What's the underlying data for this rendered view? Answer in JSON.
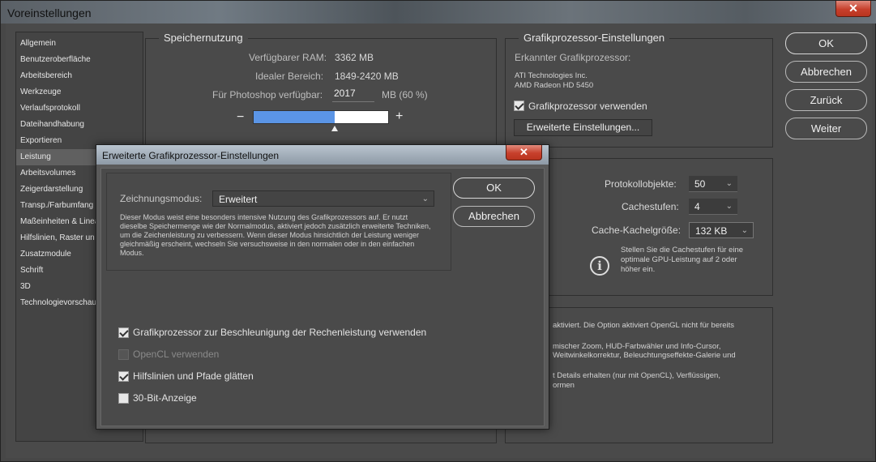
{
  "window": {
    "title": "Voreinstellungen",
    "close_glyph": "✕"
  },
  "sidebar": {
    "items": [
      {
        "label": "Allgemein"
      },
      {
        "label": "Benutzeroberfläche"
      },
      {
        "label": "Arbeitsbereich"
      },
      {
        "label": "Werkzeuge"
      },
      {
        "label": "Verlaufsprotokoll"
      },
      {
        "label": "Dateihandhabung"
      },
      {
        "label": "Exportieren"
      },
      {
        "label": "Leistung",
        "active": true
      },
      {
        "label": "Arbeitsvolumes"
      },
      {
        "label": "Zeigerdarstellung"
      },
      {
        "label": "Transp./Farbumfang"
      },
      {
        "label": "Maßeinheiten & Linea"
      },
      {
        "label": "Hilfslinien, Raster un"
      },
      {
        "label": "Zusatzmodule"
      },
      {
        "label": "Schrift"
      },
      {
        "label": "3D"
      },
      {
        "label": "Technologievorschau"
      }
    ]
  },
  "memory": {
    "title": "Speichernutzung",
    "ram_label": "Verfügbarer RAM:",
    "ram_value": "3362 MB",
    "ideal_label": "Idealer Bereich:",
    "ideal_value": "1849-2420 MB",
    "ps_label": "Für Photoshop verfügbar:",
    "ps_value": "2017",
    "ps_unit": "MB (60 %)",
    "minus": "−",
    "plus": "+",
    "slider_fraction": 0.6
  },
  "gpu": {
    "title": "Grafikprozessor-Einstellungen",
    "detected_label": "Erkannter Grafikprozessor:",
    "vendor": "ATI Technologies Inc.",
    "model": "AMD Radeon HD 5450",
    "use_gpu_label": "Grafikprozessor verwenden",
    "use_gpu_checked": true,
    "advanced_button": "Erweiterte Einstellungen..."
  },
  "history": {
    "history_label": "Protokollobjekte:",
    "history_value": "50",
    "cache_label": "Cachestufen:",
    "cache_value": "4",
    "tile_label": "Cache-Kachelgröße:",
    "tile_value": "132 KB",
    "info_text": "Stellen Sie die Cachestufen für eine optimale GPU-Leistung auf 2 oder höher ein."
  },
  "description_fragments": {
    "line1": "aktiviert. Die Option aktiviert OpenGL nicht für bereits",
    "line2": "mischer Zoom, HUD-Farbwähler und Info-Cursor,",
    "line3": "Weitwinkelkorrektur, Beleuchtungseffekte-Galerie und",
    "line4": "t Details erhalten (nur mit OpenCL), Verflüssigen,",
    "line5": "ormen"
  },
  "buttons": {
    "ok": "OK",
    "cancel": "Abbrechen",
    "back": "Zurück",
    "next": "Weiter"
  },
  "dialog": {
    "title": "Erweiterte Grafikprozessor-Einstellungen",
    "close_glyph": "✕",
    "mode_label": "Zeichnungsmodus:",
    "mode_value": "Erweitert",
    "mode_description": "Dieser Modus weist eine besonders intensive Nutzung des Grafikprozessors auf. Er nutzt dieselbe Speichermenge wie der Normalmodus, aktiviert jedoch zusätzlich erweiterte Techniken, um die Zeichenleistung zu verbessern. Wenn dieser Modus hinsichtlich der Leistung weniger gleichmäßig erscheint, wechseln Sie versuchsweise in den normalen oder in den einfachen Modus.",
    "ok": "OK",
    "cancel": "Abbrechen",
    "options": [
      {
        "label": "Grafikprozessor zur Beschleunigung der Rechenleistung verwenden",
        "checked": true,
        "disabled": false
      },
      {
        "label": "OpenCL verwenden",
        "checked": false,
        "disabled": true
      },
      {
        "label": "Hilfslinien und Pfade glätten",
        "checked": true,
        "disabled": false
      },
      {
        "label": "30-Bit-Anzeige",
        "checked": false,
        "disabled": false
      }
    ]
  },
  "colors": {
    "slider_fill": "#5b95e6",
    "dialog_bg": "#4a4a4a"
  }
}
